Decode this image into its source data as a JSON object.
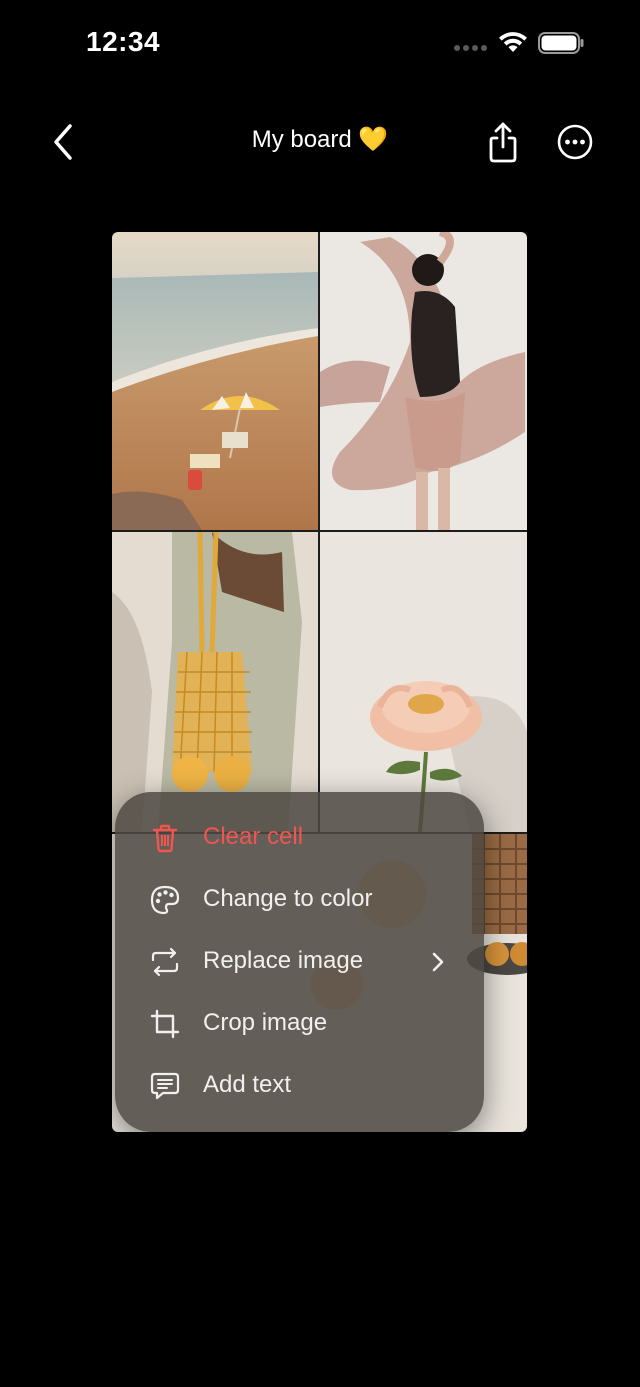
{
  "status_bar": {
    "time": "12:34"
  },
  "nav": {
    "title": "My board 💛"
  },
  "board": {
    "cells": [
      {
        "name": "beach-umbrella-photo"
      },
      {
        "name": "dancer-scarf-photo"
      },
      {
        "name": "mesh-bag-photo"
      },
      {
        "name": "peony-flower-photo"
      },
      {
        "name": "woven-basket-photo"
      }
    ]
  },
  "menu": {
    "items": [
      {
        "label": "Clear cell",
        "icon": "trash-icon",
        "color": "#f0554f"
      },
      {
        "label": "Change to color",
        "icon": "palette-icon"
      },
      {
        "label": "Replace image",
        "icon": "replace-icon",
        "submenu": true
      },
      {
        "label": "Crop image",
        "icon": "crop-icon"
      },
      {
        "label": "Add text",
        "icon": "text-bubble-icon"
      }
    ]
  }
}
